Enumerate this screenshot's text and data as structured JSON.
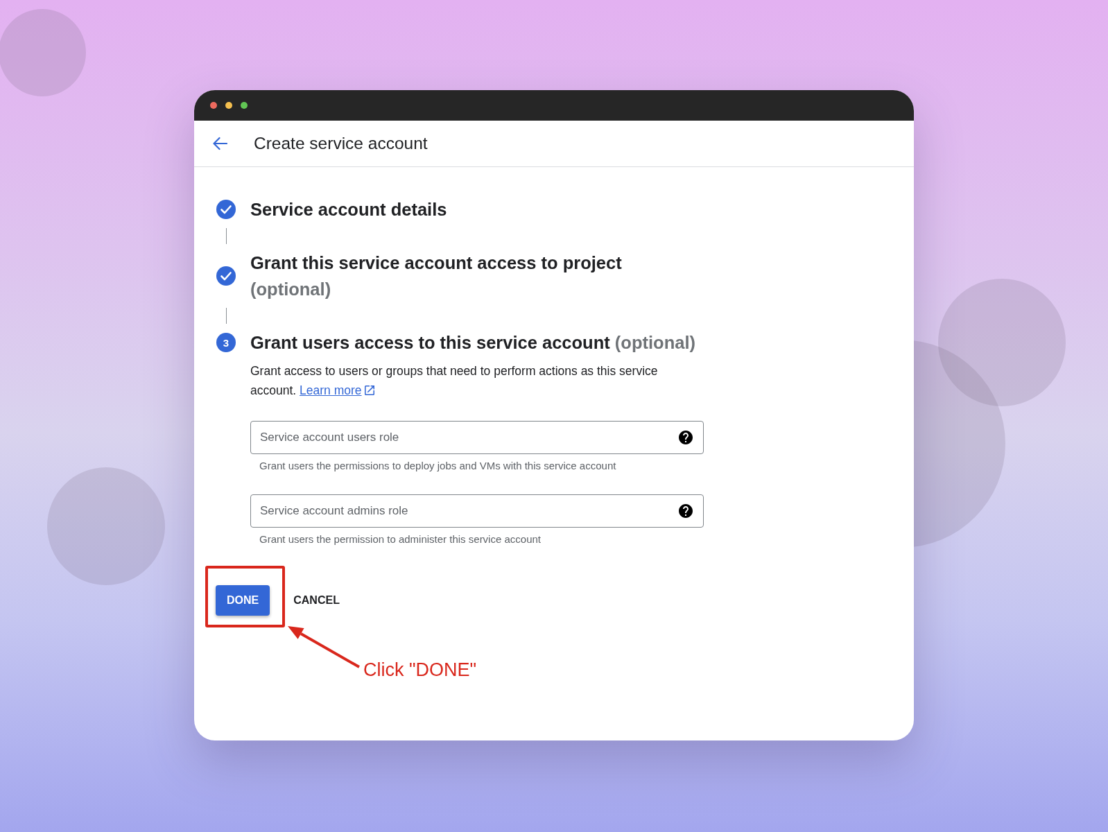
{
  "header": {
    "title": "Create service account"
  },
  "steps": [
    {
      "completed": true,
      "title": "Service account details"
    },
    {
      "completed": true,
      "title": "Grant this service account access to project",
      "note": "(optional)"
    },
    {
      "completed": false,
      "number": "3",
      "title": "Grant users access to this service account",
      "note": "(optional)",
      "description": "Grant access to users or groups that need to perform actions as this service account.",
      "link": "Learn more",
      "fields": [
        {
          "placeholder": "Service account users role",
          "hint": "Grant users the permissions to deploy jobs and VMs with this service account"
        },
        {
          "placeholder": "Service account admins role",
          "hint": "Grant users the permission to administer this service account"
        }
      ]
    }
  ],
  "actions": [
    {
      "kind": "primary",
      "label": "DONE"
    },
    {
      "kind": "text",
      "label": "CANCEL"
    }
  ],
  "annotation": {
    "label": "Click \"DONE\""
  }
}
